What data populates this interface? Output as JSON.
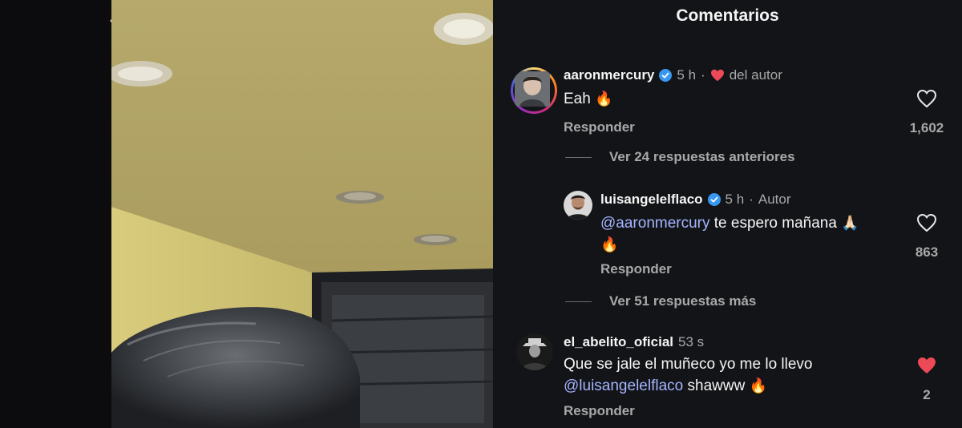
{
  "panel": {
    "title": "Comentarios"
  },
  "comments": [
    {
      "username": "aaronmercury",
      "time": "5 h",
      "separator": "·",
      "author_note": "del autor",
      "text": "Eah",
      "emoji": "🔥",
      "reply_label": "Responder",
      "likes": "1,602"
    },
    {
      "more_label": "Ver 24 respuestas anteriores"
    },
    {
      "username": "luisangelelflaco",
      "time": "5 h",
      "separator": "·",
      "author_badge": "Autor",
      "mention": "@aaronmercury",
      "text": "te espero mañana",
      "emoji_1": "🙏🏻",
      "emoji_2": "🔥",
      "reply_label": "Responder",
      "likes": "863"
    },
    {
      "more_label": "Ver 51 respuestas más"
    },
    {
      "username": "el_abelito_oficial",
      "time": "53 s",
      "text": "Que se jale el muñeco yo me lo llevo",
      "mention": "@luisangelelflaco",
      "text_2": "shawww",
      "emoji": "🔥",
      "reply_label": "Responder",
      "likes": "2",
      "liked": true
    }
  ],
  "colors": {
    "accent": "#ed4956",
    "mention": "#a6b4ff",
    "verified": "#3897f0"
  },
  "icons": [
    "chevron-left-icon",
    "verified-icon",
    "heart-icon",
    "heart-filled-icon"
  ]
}
